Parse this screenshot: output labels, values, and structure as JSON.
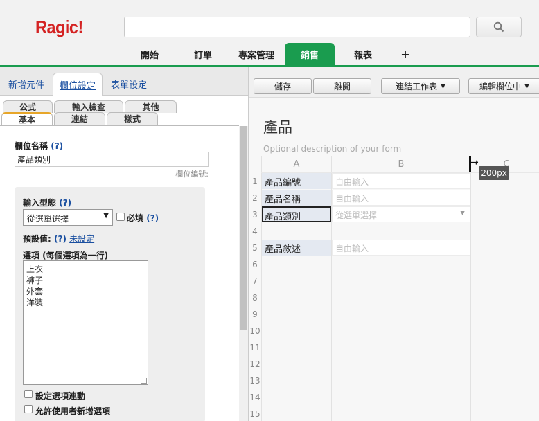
{
  "header": {
    "logo": "Ragic!",
    "search": {
      "placeholder": "",
      "value": ""
    },
    "tabs": [
      {
        "label": "開始"
      },
      {
        "label": "訂單"
      },
      {
        "label": "專案管理"
      },
      {
        "label": "銷售"
      },
      {
        "label": "報表"
      },
      {
        "label": "+"
      }
    ],
    "active_tab": "銷售",
    "accent_color": "#1a9c4f",
    "logo_color": "#d42323"
  },
  "left_panel": {
    "tabs": [
      {
        "label": "新增元件"
      },
      {
        "label": "欄位設定"
      },
      {
        "label": "表單設定"
      }
    ],
    "subtabs_top": [
      {
        "label": "公式"
      },
      {
        "label": "輸入檢查"
      },
      {
        "label": "其他"
      }
    ],
    "subtabs_bottom": [
      {
        "label": "基本"
      },
      {
        "label": "連結"
      },
      {
        "label": "樣式"
      }
    ],
    "field_name_label": "欄位名稱",
    "help_mark": "(?)",
    "field_name_value": "產品類別",
    "field_id_note": "欄位編號:",
    "input_type_label": "輸入型態",
    "input_type_value": "從選單選擇",
    "required_label": "必填",
    "default_label": "預設值:",
    "default_link": "未設定",
    "options_label": "選項 (每個選項為一行)",
    "options": [
      "上衣",
      "褲子",
      "外套",
      "洋裝"
    ],
    "linked_options_label": "設定選項連動",
    "allow_add_label": "允許使用者新增選項"
  },
  "toolbar": {
    "save": "儲存",
    "leave": "離開",
    "link_sheet": "連結工作表",
    "edit_fields": "編輯欄位中"
  },
  "form": {
    "title": "產品",
    "description": "Optional description of your form",
    "columns": [
      "A",
      "B",
      "C"
    ],
    "rows": [
      "1",
      "2",
      "3",
      "4",
      "5",
      "6",
      "7",
      "8",
      "9",
      "10",
      "11",
      "12",
      "13",
      "14",
      "15"
    ],
    "fields": [
      {
        "row": "1",
        "label": "產品編號",
        "placeholder": "自由輸入"
      },
      {
        "row": "2",
        "label": "產品名稱",
        "placeholder": "自由輸入"
      },
      {
        "row": "3",
        "label": "產品類別",
        "placeholder": "從選單選擇"
      },
      {
        "row": "5",
        "label": "產品敘述",
        "placeholder": "自由輸入"
      }
    ],
    "width_tooltip": "200px"
  }
}
